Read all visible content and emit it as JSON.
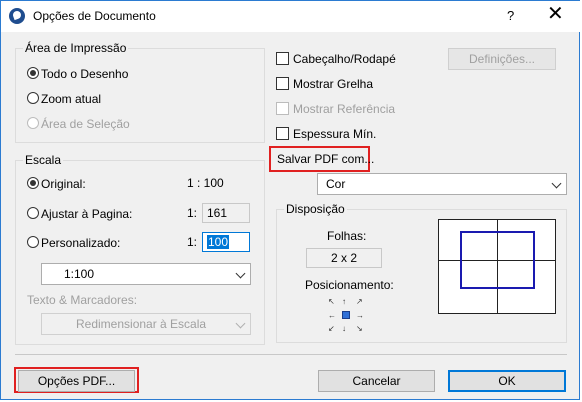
{
  "window": {
    "title": "Opções de Documento",
    "help": "?",
    "close": "✕"
  },
  "print_area": {
    "legend": "Área de Impressão",
    "options": [
      "Todo o Desenho",
      "Zoom atual",
      "Área de Seleção"
    ]
  },
  "scale": {
    "legend": "Escala",
    "original_label": "Original:",
    "original_value": "1 : 100",
    "fit_label": "Ajustar à Pagina:",
    "fit_prefix": "1:",
    "fit_value": "161",
    "custom_label": "Personalizado:",
    "custom_prefix": "1:",
    "custom_value": "100",
    "scale_select": "1:100"
  },
  "text_markers": {
    "label": "Texto & Marcadores:",
    "select": "Redimensionar à Escala"
  },
  "header_footer": {
    "label": "Cabeçalho/Rodapé",
    "settings_button": "Definições..."
  },
  "show_grid": "Mostrar Grelha",
  "show_reference": "Mostrar Referência",
  "min_thickness": "Espessura Mín.",
  "save_pdf": {
    "label": "Salvar PDF com...",
    "select": "Cor"
  },
  "layout": {
    "legend": "Disposição",
    "sheets_label": "Folhas:",
    "sheets_value": "2 x 2",
    "positioning_label": "Posicionamento:"
  },
  "footer": {
    "pdf_options": "Opções PDF...",
    "cancel": "Cancelar",
    "ok": "OK"
  },
  "colors": {
    "accent": "#0078d7",
    "highlight": "#e02020",
    "preview_frame": "#1a1ab0"
  },
  "icons": [
    "app-logo-icon",
    "help-icon",
    "close-icon",
    "chevron-down-icon",
    "position-arrows-icon"
  ]
}
